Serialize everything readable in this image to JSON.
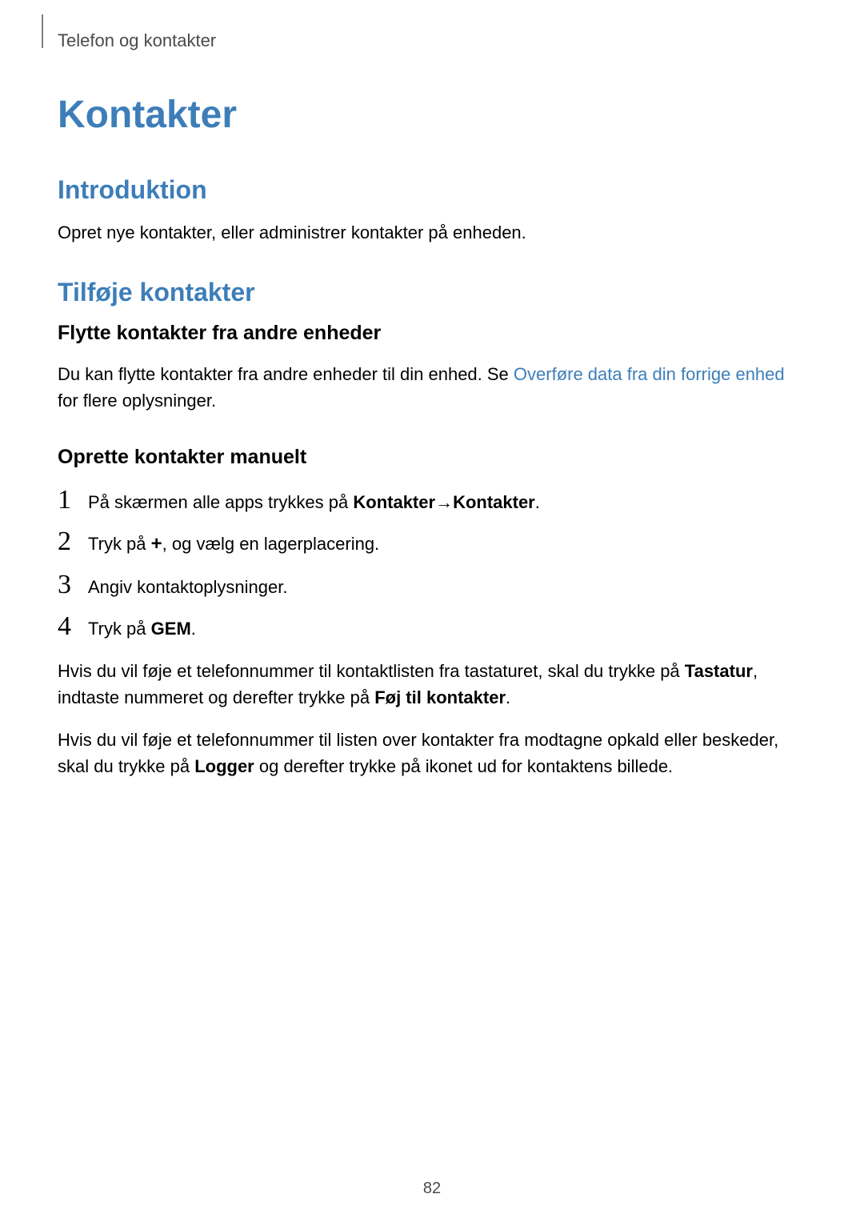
{
  "breadcrumb": "Telefon og kontakter",
  "main_title": "Kontakter",
  "sections": {
    "intro": {
      "title": "Introduktion",
      "body": "Opret nye kontakter, eller administrer kontakter på enheden."
    },
    "add_contacts": {
      "title": "Tilføje kontakter",
      "sub1": {
        "title": "Flytte kontakter fra andre enheder",
        "body_pre": "Du kan flytte kontakter fra andre enheder til din enhed. Se ",
        "link": "Overføre data fra din forrige enhed",
        "body_post": " for flere oplysninger."
      },
      "sub2": {
        "title": "Oprette kontakter manuelt",
        "steps": {
          "s1": {
            "num": "1",
            "pre": "På skærmen alle apps trykkes på ",
            "b1": "Kontakter",
            "arrow": " → ",
            "b2": "Kontakter",
            "post": "."
          },
          "s2": {
            "num": "2",
            "pre": "Tryk på ",
            "icon": "+",
            "post": ", og vælg en lagerplacering."
          },
          "s3": {
            "num": "3",
            "text": "Angiv kontaktoplysninger."
          },
          "s4": {
            "num": "4",
            "pre": "Tryk på ",
            "b1": "GEM",
            "post": "."
          }
        },
        "para1": {
          "pre": "Hvis du vil føje et telefonnummer til kontaktlisten fra tastaturet, skal du trykke på ",
          "b1": "Tastatur",
          "mid": ", indtaste nummeret og derefter trykke på ",
          "b2": "Føj til kontakter",
          "post": "."
        },
        "para2": {
          "pre": "Hvis du vil føje et telefonnummer til listen over kontakter fra modtagne opkald eller beskeder, skal du trykke på ",
          "b1": "Logger",
          "post": " og derefter trykke på ikonet ud for kontaktens billede."
        }
      }
    }
  },
  "page_number": "82"
}
